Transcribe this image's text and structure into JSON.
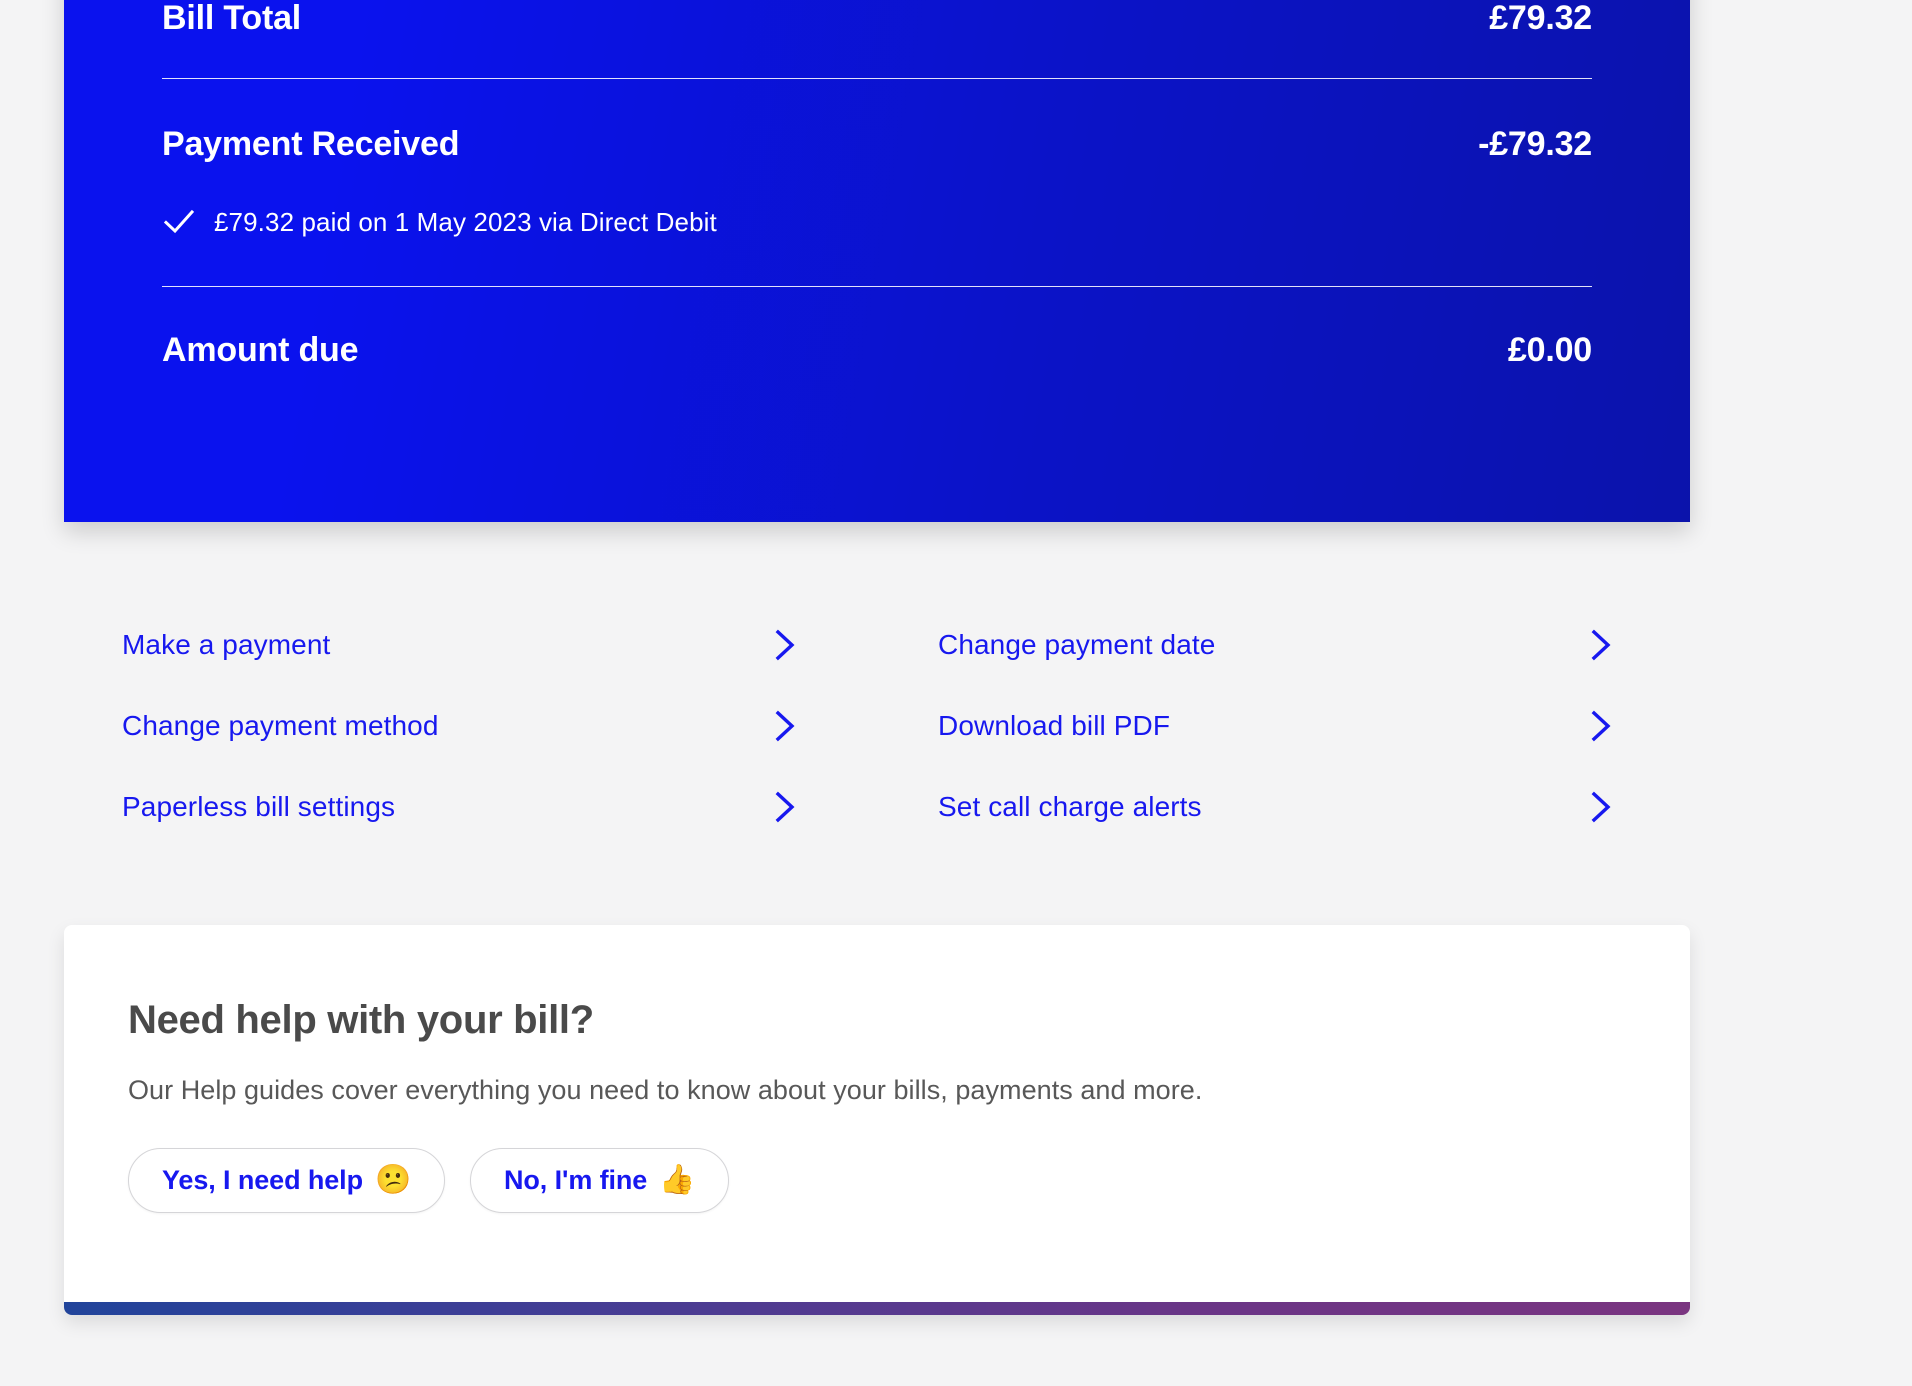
{
  "colors": {
    "page_background": "#f4f4f5",
    "bill_card_gradient_start": "#0a12ee",
    "bill_card_gradient_end": "#0b13ab",
    "link_blue": "#1718ef",
    "accent_bar_start": "#21449a",
    "accent_bar_end": "#7a3580",
    "help_title_grey": "#4a4a4a"
  },
  "bill_summary": {
    "rows": [
      {
        "label": "Bill Total",
        "amount": "£79.32"
      },
      {
        "label": "Payment Received",
        "amount": "-£79.32"
      },
      {
        "label": "Amount due",
        "amount": "£0.00"
      }
    ],
    "bill_total_label": "Bill Total",
    "bill_total_amount": "£79.32",
    "payment_received_label": "Payment Received",
    "payment_received_amount": "-£79.32",
    "payment_note": "£79.32 paid on 1 May 2023 via Direct Debit",
    "payment_note_icon": "check-icon",
    "amount_due_label": "Amount due",
    "amount_due_amount": "£0.00"
  },
  "quick_links": {
    "items": [
      {
        "label": "Make a payment",
        "icon": "chevron-right-icon"
      },
      {
        "label": "Change payment date",
        "icon": "chevron-right-icon"
      },
      {
        "label": "Change payment method",
        "icon": "chevron-right-icon"
      },
      {
        "label": "Download bill PDF",
        "icon": "chevron-right-icon"
      },
      {
        "label": "Paperless bill settings",
        "icon": "chevron-right-icon"
      },
      {
        "label": "Set call charge alerts",
        "icon": "chevron-right-icon"
      }
    ]
  },
  "help_card": {
    "title": "Need help with your bill?",
    "subtitle": "Our Help guides cover everything you need to know about your bills, payments and more.",
    "buttons": [
      {
        "label": "Yes, I need help",
        "emoji": "😕",
        "icon": "confused-face-emoji"
      },
      {
        "label": "No, I'm fine",
        "emoji": "👍",
        "icon": "thumbs-up-emoji"
      }
    ]
  }
}
